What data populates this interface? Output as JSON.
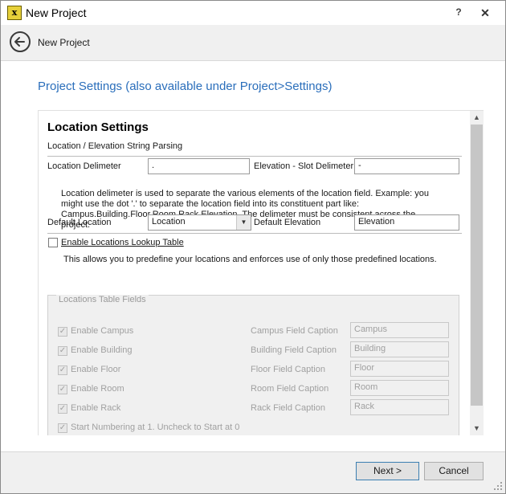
{
  "window": {
    "title": "New Project",
    "help_glyph": "?",
    "close_glyph": "✕"
  },
  "nav": {
    "title": "New Project"
  },
  "page": {
    "heading": "Project Settings (also available under Project>Settings)"
  },
  "location_settings": {
    "title": "Location Settings",
    "subhead": "Location / Elevation String Parsing",
    "location_delimeter_label": "Location Delimeter",
    "location_delimeter_value": ".",
    "elevation_delimeter_label": "Elevation - Slot Delimeter",
    "elevation_delimeter_value": "-",
    "description": "Location delimeter is used to separate the various elements of the location field. Example: you might use the dot '.' to separate the location field into its constituent part like: Campus.Building.Floor.Room.Rack.Elevation. The delimeter must be consistent across the project.",
    "default_location_label": "Default Location",
    "default_location_value": "Location",
    "default_elevation_label": "Default Elevation",
    "default_elevation_value": "Elevation",
    "lookup_label": "Enable Locations Lookup Table",
    "lookup_checked": false,
    "lookup_hint": "This allows you to predefine your locations and enforces use of only those predefined locations."
  },
  "locations_table": {
    "legend": "Locations Table Fields",
    "check_glyph": "✓",
    "rows": [
      {
        "enable_label": "Enable Campus",
        "caption_label": "Campus Field Caption",
        "caption_value": "Campus"
      },
      {
        "enable_label": "Enable Building",
        "caption_label": "Building Field Caption",
        "caption_value": "Building"
      },
      {
        "enable_label": "Enable Floor",
        "caption_label": "Floor Field Caption",
        "caption_value": "Floor"
      },
      {
        "enable_label": "Enable Room",
        "caption_label": "Room Field Caption",
        "caption_value": "Room"
      },
      {
        "enable_label": "Enable Rack",
        "caption_label": "Rack Field Caption",
        "caption_value": "Rack"
      }
    ],
    "numbering_label": "Start Numbering at 1. Uncheck to Start at 0"
  },
  "scroll": {
    "up_glyph": "▲",
    "down_glyph": "▼"
  },
  "footer": {
    "next_label": "Next >",
    "cancel_label": "Cancel"
  }
}
